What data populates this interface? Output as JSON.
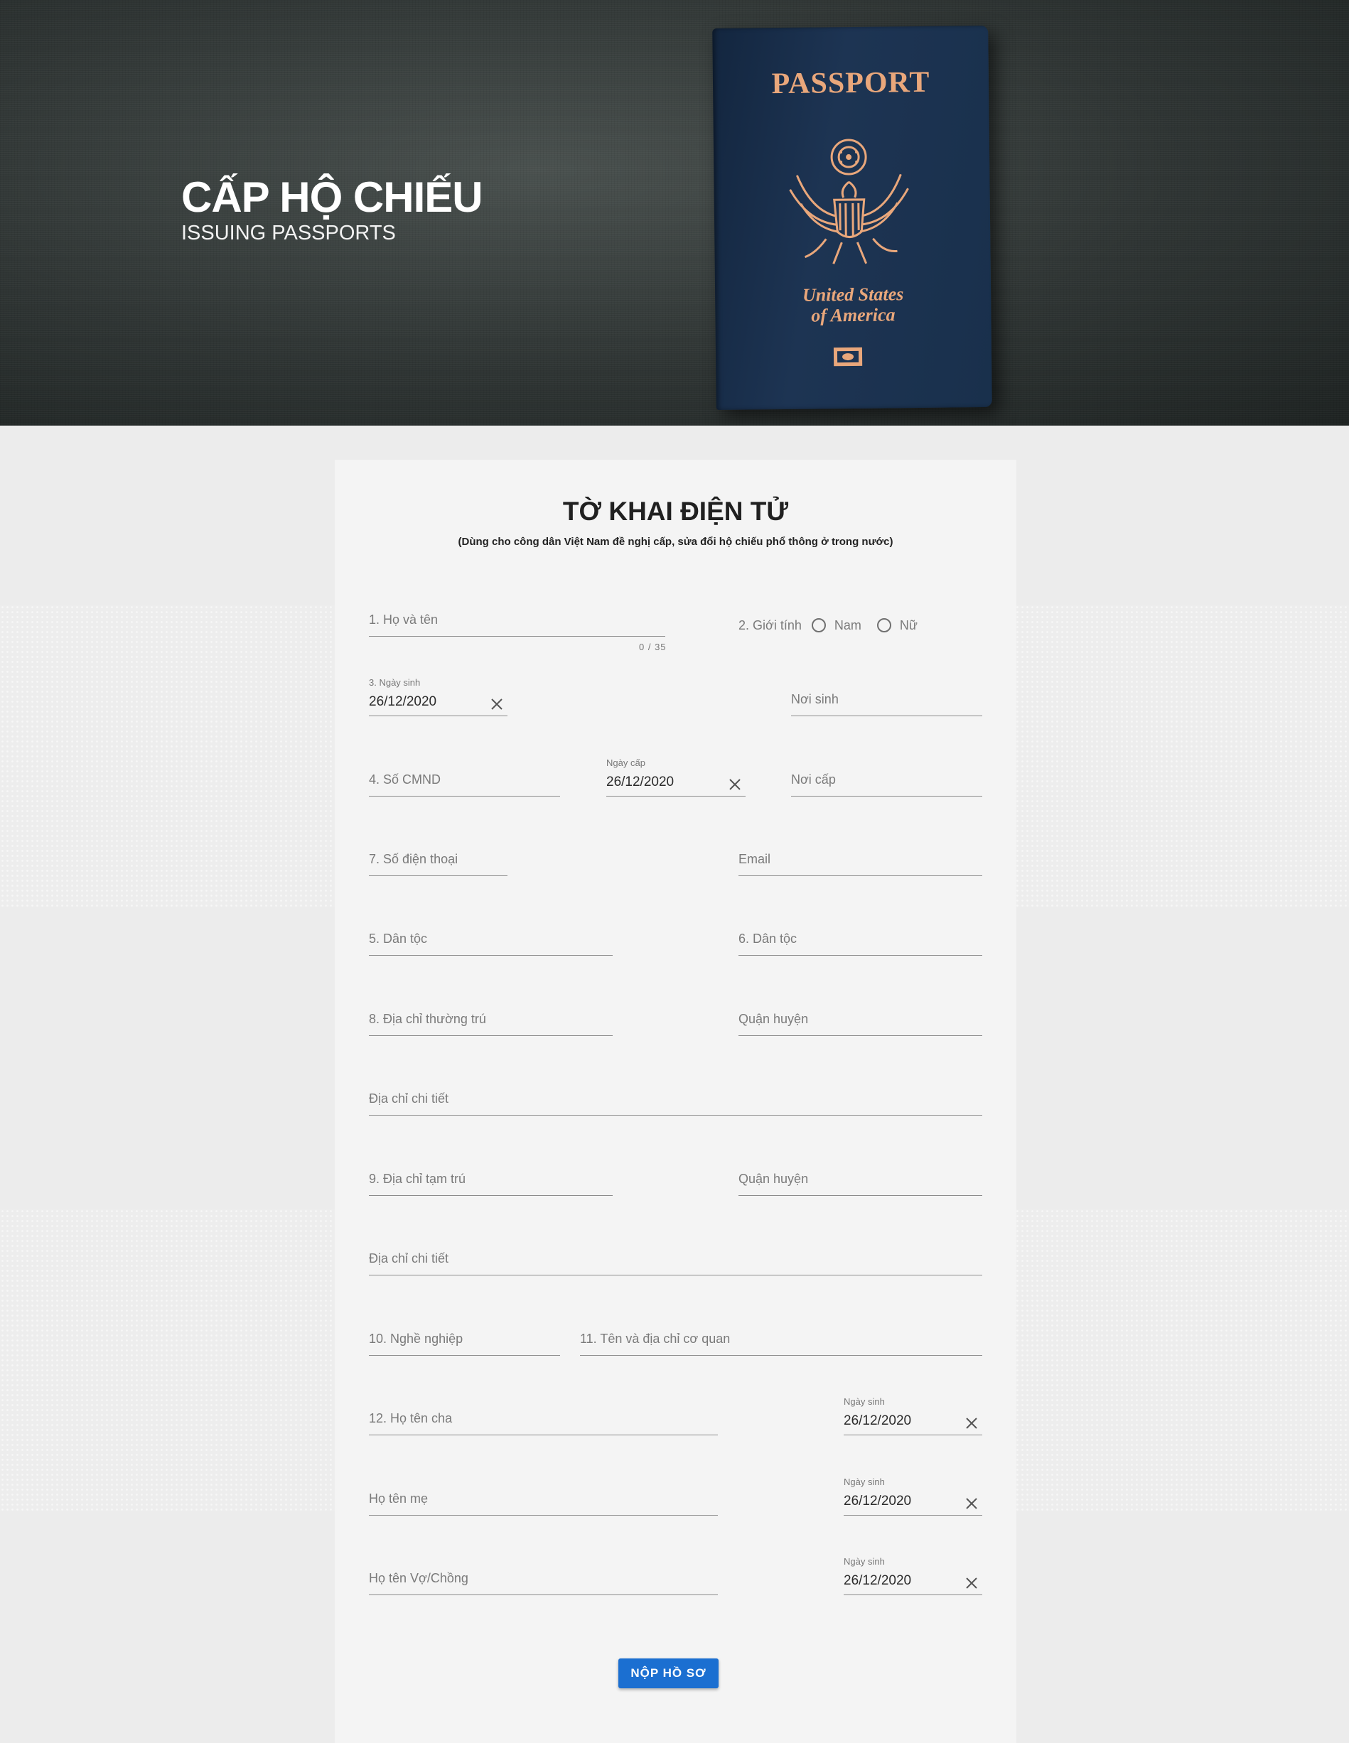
{
  "hero": {
    "title": "CẤP HỘ CHIẾU",
    "subtitle": "ISSUING PASSPORTS",
    "passport_word": "PASSPORT",
    "passport_country_line1": "United States",
    "passport_country_line2": "of America",
    "accent_color": "#e9a77b"
  },
  "form": {
    "title": "TỜ KHAI ĐIỆN TỬ",
    "note": "(Dùng cho công dân Việt Nam đề nghị cấp, sửa đổi hộ chiếu phổ thông ở trong nước)",
    "full_name": {
      "placeholder": "1. Họ và tên",
      "counter": "0 / 35"
    },
    "gender": {
      "label": "2. Giới tính",
      "options": [
        "Nam",
        "Nữ"
      ]
    },
    "birth_date": {
      "label": "3. Ngày sinh",
      "value": "26/12/2020"
    },
    "birth_place": {
      "placeholder": "Nơi sinh"
    },
    "id_number": {
      "placeholder": "4. Số CMND"
    },
    "issue_date": {
      "label": "Ngày cấp",
      "value": "26/12/2020"
    },
    "issue_place": {
      "placeholder": "Nơi cấp"
    },
    "phone": {
      "placeholder": "7. Số điện thoại"
    },
    "email": {
      "placeholder": "Email"
    },
    "ethnicity": {
      "placeholder": "5. Dân tộc"
    },
    "religion": {
      "placeholder": "6. Dân tộc"
    },
    "permanent_address": {
      "placeholder": "8. Địa chỉ thường trú"
    },
    "permanent_district": {
      "placeholder": "Quận huyện"
    },
    "permanent_detail": {
      "placeholder": "Địa chỉ chi tiết"
    },
    "temporary_address": {
      "placeholder": "9. Địa chỉ tạm trú"
    },
    "temporary_district": {
      "placeholder": "Quận huyện"
    },
    "temporary_detail": {
      "placeholder": "Địa chỉ chi tiết"
    },
    "occupation": {
      "placeholder": "10. Nghề nghiệp"
    },
    "workplace": {
      "placeholder": "11. Tên và địa chỉ cơ quan"
    },
    "father_name": {
      "placeholder": "12. Họ tên cha"
    },
    "father_birth": {
      "label": "Ngày sinh",
      "value": "26/12/2020"
    },
    "mother_name": {
      "placeholder": "Họ tên mẹ"
    },
    "mother_birth": {
      "label": "Ngày sinh",
      "value": "26/12/2020"
    },
    "spouse_name": {
      "placeholder": "Họ tên Vợ/Chồng"
    },
    "spouse_birth": {
      "label": "Ngày sinh",
      "value": "26/12/2020"
    },
    "submit_label": "NỘP HỒ SƠ",
    "submit_color": "#1b6fd1"
  }
}
